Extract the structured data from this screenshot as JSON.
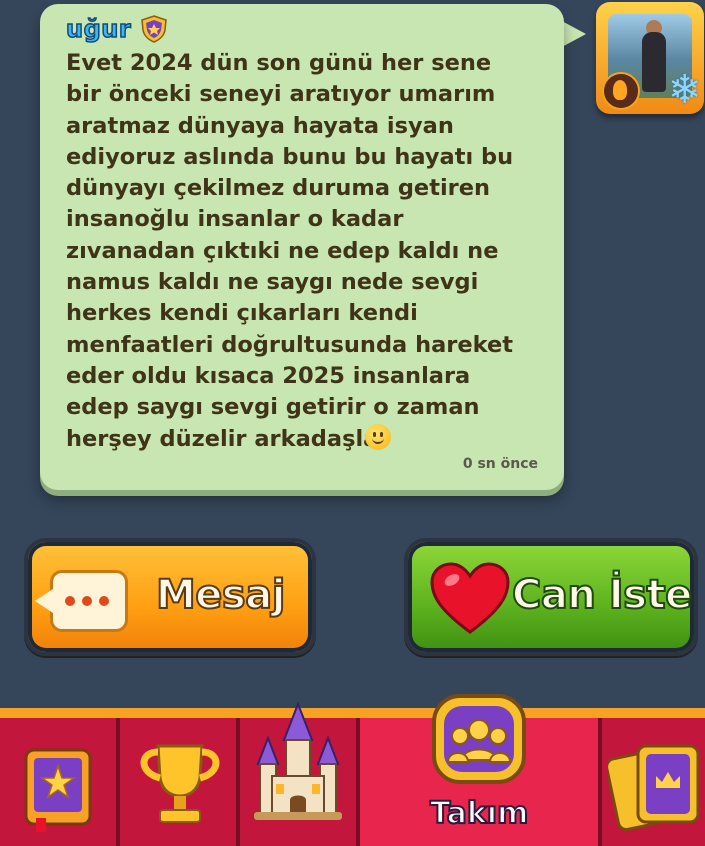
{
  "chat": {
    "sender_name": "uğur",
    "message": "Evet 2024 dün son günü her sene\nbir önceki seneyi aratıyor umarım\naratmaz  dünyaya hayata isyan\nediyoruz aslında bunu bu hayatı bu\ndünyayı çekilmez duruma getiren\ninsanoğlu insanlar o kadar\nzıvanadan çıktıki ne edep kaldı ne\nnamus kaldı ne saygı nede sevgi\nherkes kendi çıkarları kendi\nmenfaatleri doğrultusunda hareket\neder oldu kısaca 2025 insanlara\nedep saygı sevgi getirir o zaman\nherşey düzelir arkadaşlar",
    "timestamp": "0 sn önce"
  },
  "actions": {
    "message_label": "Mesaj",
    "ask_life_label": "Can İste"
  },
  "nav": {
    "items": [
      {
        "icon": "star-book-icon"
      },
      {
        "icon": "trophy-icon"
      },
      {
        "icon": "castle-icon"
      },
      {
        "icon": "team-icon",
        "label": "Takım",
        "active": true
      },
      {
        "icon": "cards-icon"
      }
    ]
  },
  "colors": {
    "background": "#35465a",
    "bubble": "#c8e6b2",
    "message_button": "#ff9f12",
    "ask_life_button": "#5cb11e",
    "nav_bar": "#c2163c",
    "nav_border": "#f7a224",
    "sender_name": "#3fb6f0"
  }
}
